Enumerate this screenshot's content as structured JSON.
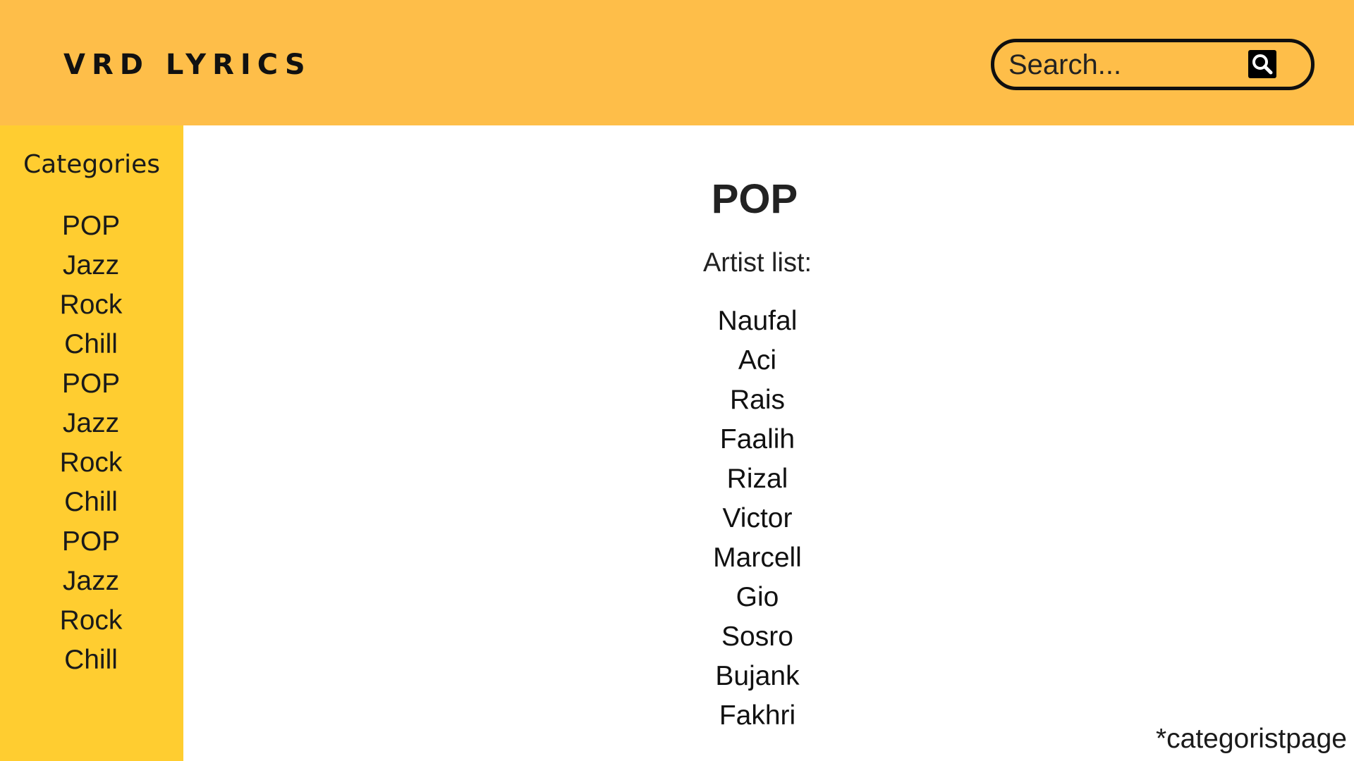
{
  "header": {
    "brand": "VRD LYRICS",
    "search": {
      "placeholder": "Search...",
      "icon": "search-icon"
    }
  },
  "sidebar": {
    "title": "Categories",
    "items": [
      {
        "label": "POP"
      },
      {
        "label": "Jazz"
      },
      {
        "label": "Rock"
      },
      {
        "label": "Chill"
      },
      {
        "label": "POP"
      },
      {
        "label": "Jazz"
      },
      {
        "label": "Rock"
      },
      {
        "label": "Chill"
      },
      {
        "label": "POP"
      },
      {
        "label": "Jazz"
      },
      {
        "label": "Rock"
      },
      {
        "label": "Chill"
      }
    ]
  },
  "main": {
    "title": "POP",
    "artist_list_label": "Artist list:",
    "artists": [
      {
        "name": "Naufal"
      },
      {
        "name": "Aci"
      },
      {
        "name": "Rais"
      },
      {
        "name": "Faalih"
      },
      {
        "name": "Rizal"
      },
      {
        "name": "Victor"
      },
      {
        "name": "Marcell"
      },
      {
        "name": "Gio"
      },
      {
        "name": "Sosro"
      },
      {
        "name": "Bujank"
      },
      {
        "name": "Fakhri"
      }
    ]
  },
  "footer_note": "*categoristpage",
  "colors": {
    "header_bg": "#FEBE49",
    "sidebar_bg": "#FFCD30",
    "text": "#1a1a1a"
  }
}
